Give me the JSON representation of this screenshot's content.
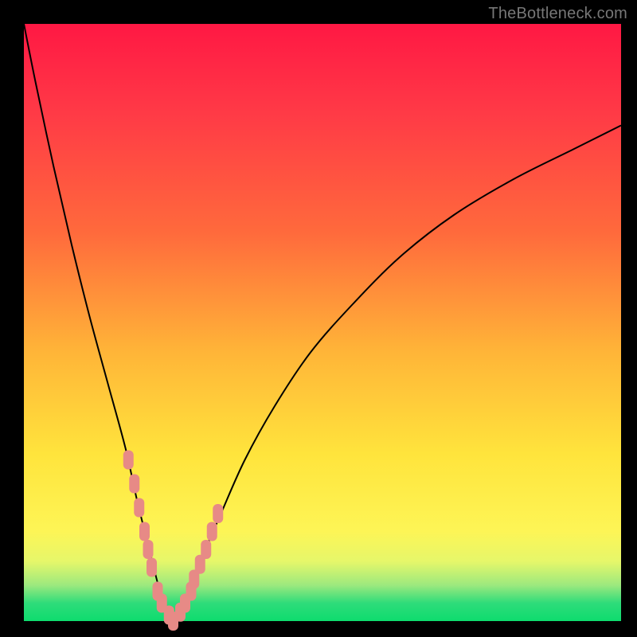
{
  "watermark": "TheBottleneck.com",
  "colors": {
    "frame": "#000000",
    "curve": "#000000",
    "marker": "#e78a86",
    "gradient_top": "#ff1844",
    "gradient_bottom": "#0edc6e"
  },
  "chart_data": {
    "type": "line",
    "title": "",
    "xlabel": "",
    "ylabel": "",
    "xlim": [
      0,
      100
    ],
    "ylim": [
      0,
      100
    ],
    "x": [
      0,
      2,
      5,
      8,
      11,
      14,
      17,
      19,
      21,
      22.5,
      24,
      25,
      26,
      28,
      30,
      33,
      37,
      42,
      48,
      55,
      63,
      72,
      82,
      92,
      100
    ],
    "values": [
      100,
      90,
      76,
      63,
      51,
      40,
      29,
      20,
      12,
      6,
      1,
      0,
      1,
      5,
      11,
      18,
      27,
      36,
      45,
      53,
      61,
      68,
      74,
      79,
      83
    ],
    "annotations": [],
    "markers_x": [
      17.5,
      18.5,
      19.3,
      20.2,
      20.8,
      21.4,
      22.4,
      23.1,
      24.3,
      25,
      26.2,
      27,
      28,
      28.5,
      29.5,
      30.5,
      31.5,
      32.5
    ],
    "markers_y": [
      27,
      23,
      19,
      15,
      12,
      9,
      5,
      3,
      1,
      0,
      1.5,
      3,
      5,
      7,
      9.5,
      12,
      15,
      18
    ]
  }
}
